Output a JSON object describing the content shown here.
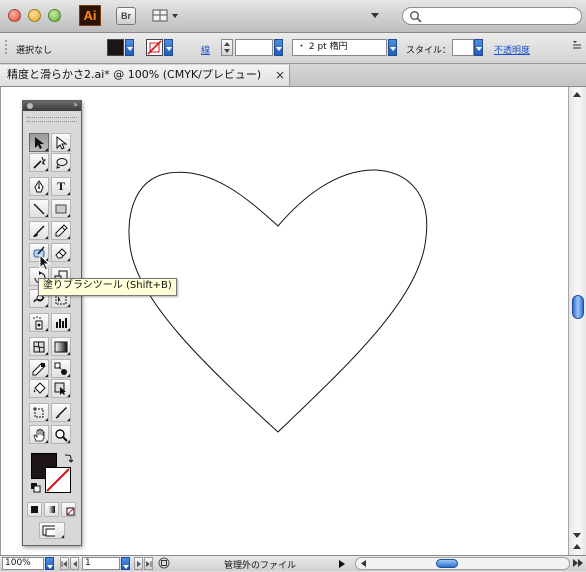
{
  "app": {
    "logo_text": "Ai",
    "bridge_label": "Br",
    "search": {
      "placeholder": ""
    },
    "colors": {
      "accent": "#1d5bbf",
      "logo_bg": "#2b1203",
      "logo_fg": "#ff8a1a"
    }
  },
  "control_bar": {
    "selection_label": "選択なし",
    "fill_color": "#1c1416",
    "stroke_label": "線",
    "stroke_width_value": "",
    "brush_value": "・ 2 pt 楕円",
    "style_label": "スタイル：",
    "opacity_label": "不透明度"
  },
  "document_tab": {
    "title": "精度と滑らかさ2.ai* @ 100% (CMYK/プレビュー)",
    "close_glyph": "×"
  },
  "toolbox": {
    "tooltip": "塗りブラシツール (Shift+B)",
    "type_tool_glyph": "T",
    "fill_swatch": "#1c1416",
    "tools": [
      "selection-tool",
      "direct-selection-tool",
      "magic-wand-tool",
      "lasso-tool",
      "pen-tool",
      "type-tool",
      "line-segment-tool",
      "rectangle-tool",
      "paintbrush-tool",
      "pencil-tool",
      "blob-brush-tool",
      "eraser-tool",
      "rotate-tool",
      "scale-tool",
      "warp-tool",
      "free-transform-tool",
      "symbol-sprayer-tool",
      "column-graph-tool",
      "mesh-tool",
      "gradient-tool",
      "eyedropper-tool",
      "blend-tool",
      "live-paint-bucket-tool",
      "live-paint-selection-tool",
      "crop-area-tool",
      "slice-tool",
      "hand-tool",
      "zoom-tool"
    ]
  },
  "artwork": {
    "shape": "heart",
    "stroke": "#111111",
    "fill": "none"
  },
  "status_bar": {
    "zoom_value": "100%",
    "page_value": "1",
    "status_text": "管理外のファイル"
  }
}
